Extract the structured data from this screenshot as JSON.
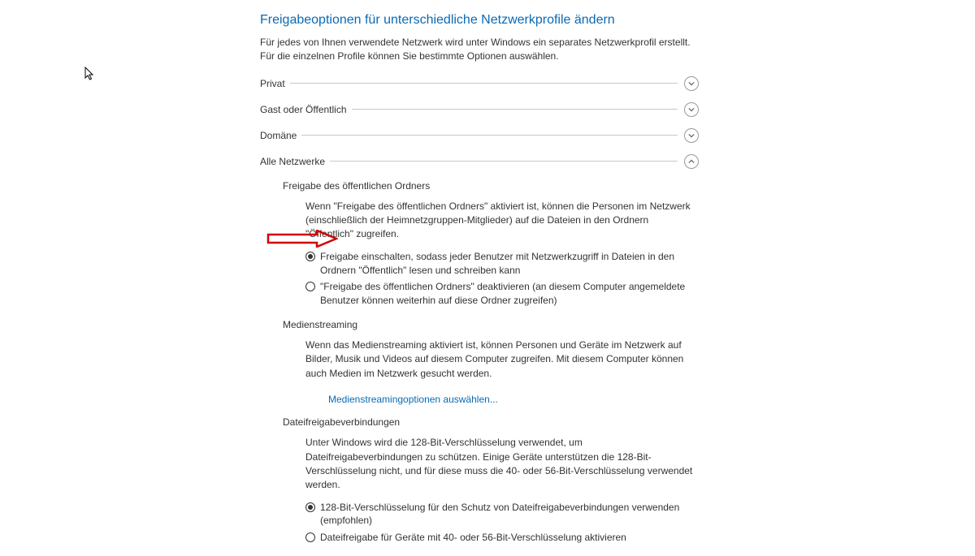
{
  "page": {
    "title": "Freigabeoptionen für unterschiedliche Netzwerkprofile ändern",
    "description": "Für jedes von Ihnen verwendete Netzwerk wird unter Windows ein separates Netzwerkprofil erstellt. Für die einzelnen Profile können Sie bestimmte Optionen auswählen."
  },
  "sections": {
    "privat": {
      "label": "Privat"
    },
    "gast": {
      "label": "Gast oder Öffentlich"
    },
    "domaene": {
      "label": "Domäne"
    },
    "alle": {
      "label": "Alle Netzwerke"
    }
  },
  "pubFolder": {
    "title": "Freigabe des öffentlichen Ordners",
    "desc": "Wenn \"Freigabe des öffentlichen Ordners\" aktiviert ist, können die Personen im Netzwerk (einschließlich der Heimnetzgruppen-Mitglieder) auf die Dateien in den Ordnern \"Öffentlich\" zugreifen.",
    "opt1": "Freigabe einschalten, sodass jeder Benutzer mit Netzwerkzugriff in Dateien in den Ordnern \"Öffentlich\" lesen und schreiben kann",
    "opt2": "\"Freigabe des öffentlichen Ordners\" deaktivieren (an diesem Computer angemeldete Benutzer können weiterhin auf diese Ordner zugreifen)"
  },
  "media": {
    "title": "Medienstreaming",
    "desc": "Wenn das Medienstreaming aktiviert ist, können Personen und Geräte im Netzwerk auf Bilder, Musik und Videos auf diesem Computer zugreifen. Mit diesem Computer können auch Medien im Netzwerk gesucht werden.",
    "link": "Medienstreamingoptionen auswählen..."
  },
  "fileConn": {
    "title": "Dateifreigabeverbindungen",
    "desc": "Unter Windows wird die 128-Bit-Verschlüsselung verwendet, um Dateifreigabeverbindungen zu schützen. Einige Geräte unterstützen die 128-Bit-Verschlüsselung nicht, und für diese muss die 40- oder 56-Bit-Verschlüsselung verwendet werden.",
    "opt1": "128-Bit-Verschlüsselung für den Schutz von Dateifreigabeverbindungen verwenden (empfohlen)",
    "opt2": "Dateifreigabe für Geräte mit 40- oder 56-Bit-Verschlüsselung aktivieren"
  }
}
